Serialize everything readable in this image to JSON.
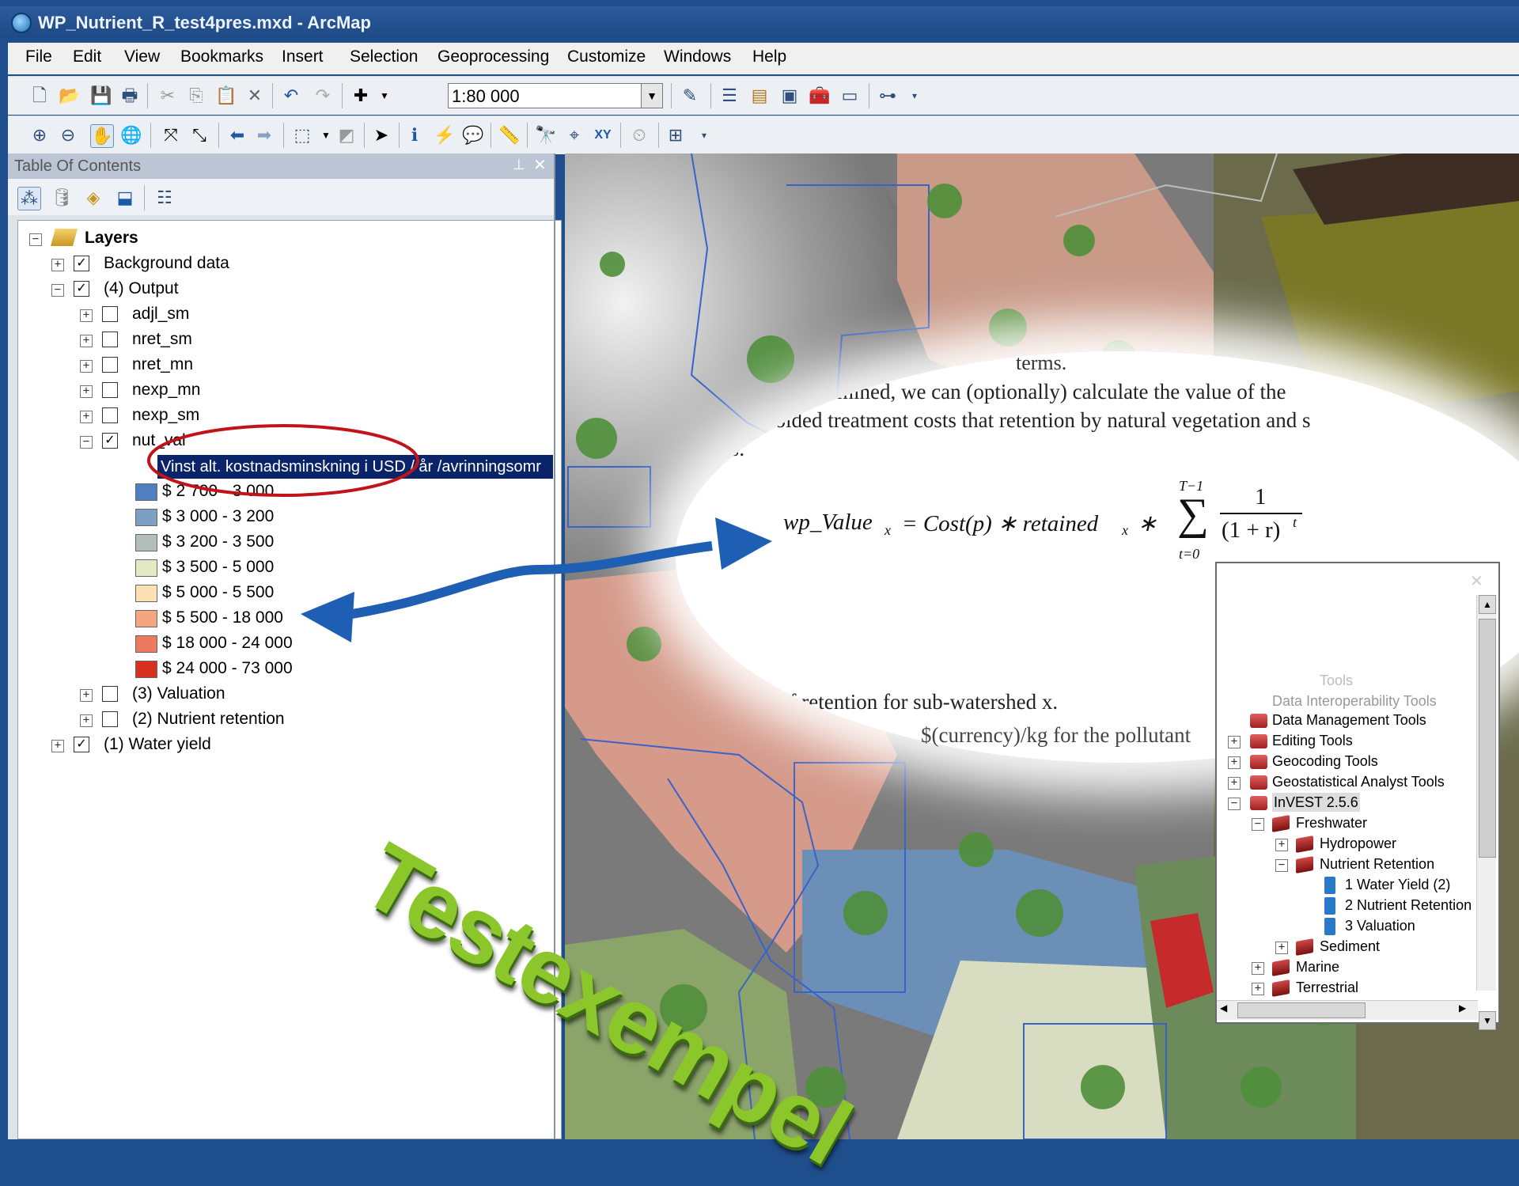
{
  "window": {
    "title": "WP_Nutrient_R_test4pres.mxd - ArcMap"
  },
  "menu": [
    "File",
    "Edit",
    "View",
    "Bookmarks",
    "Insert",
    "Selection",
    "Geoprocessing",
    "Customize",
    "Windows",
    "Help"
  ],
  "toolbar": {
    "scale_value": "1:80 000"
  },
  "toc": {
    "title": "Table Of Contents",
    "root": "Layers",
    "layers": [
      {
        "label": "Background data"
      },
      {
        "label": "(4) Output"
      },
      {
        "label": "adjl_sm"
      },
      {
        "label": "nret_sm"
      },
      {
        "label": "nret_mn"
      },
      {
        "label": "nexp_mn"
      },
      {
        "label": "nexp_sm"
      },
      {
        "label": "nut_val"
      },
      {
        "label": "(3) Valuation"
      },
      {
        "label": "(2) Nutrient retention"
      },
      {
        "label": "(1) Water yield"
      }
    ],
    "field_label": "Vinst alt. kostnadsminskning i USD / år /avrinningsomr",
    "legend": [
      {
        "label": "$ 2 700 - 3 000",
        "color": "#4f7fbf"
      },
      {
        "label": "$ 3 000 - 3 200",
        "color": "#7e9fc4"
      },
      {
        "label": "$ 3 200 - 3 500",
        "color": "#b2bfbd"
      },
      {
        "label": "$ 3 500 - 5 000",
        "color": "#e5e9c6"
      },
      {
        "label": "$ 5 000 - 5 500",
        "color": "#fde1b6"
      },
      {
        "label": "$ 5 500 - 18 000",
        "color": "#f4a582"
      },
      {
        "label": "$ 18 000 - 24 000",
        "color": "#ec7a5e"
      },
      {
        "label": "$ 24 000 - 73 000",
        "color": "#d7301f"
      }
    ]
  },
  "formula": {
    "text_top": "terms.",
    "line1": "determined, we can (optionally) calculate the value of the",
    "line2": "avoided treatment costs that retention by natural vegetation and s",
    "line3": "ws:",
    "lhs": "wp_Value",
    "lhs_sub": "x",
    "rhs1": "= Cost(p) ∗ retained",
    "rhs_sub": "x",
    "times": "∗",
    "sum_top": "T−1",
    "sum_bottom": "t=0",
    "frac_num": "1",
    "frac_den": "(1 + r)",
    "frac_exp": "t",
    "line4": "of retention for sub-watershed x.",
    "line5": "$(currency)/kg for the pollutant"
  },
  "overlay": {
    "word": "Testexempel"
  },
  "arctoolbox": {
    "items": [
      {
        "label": "Tools"
      },
      {
        "label": "Data Interoperability Tools"
      },
      {
        "label": "Data Management Tools"
      },
      {
        "label": "Editing Tools"
      },
      {
        "label": "Geocoding Tools"
      },
      {
        "label": "Geostatistical Analyst Tools"
      },
      {
        "label": "InVEST 2.5.6"
      },
      {
        "label": "Freshwater"
      },
      {
        "label": "Hydropower"
      },
      {
        "label": "Nutrient Retention"
      },
      {
        "label": "1 Water Yield (2)"
      },
      {
        "label": "2 Nutrient Retention"
      },
      {
        "label": "3 Valuation"
      },
      {
        "label": "Sediment"
      },
      {
        "label": "Marine"
      },
      {
        "label": "Terrestrial"
      }
    ]
  }
}
